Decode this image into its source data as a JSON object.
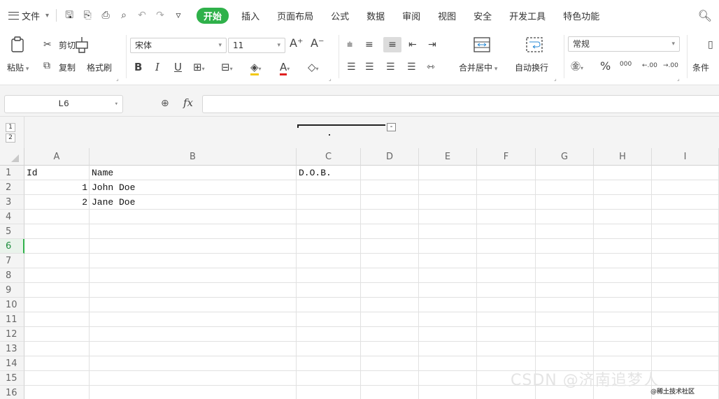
{
  "menu": {
    "file_label": "文件",
    "tabs": [
      "开始",
      "插入",
      "页面布局",
      "公式",
      "数据",
      "审阅",
      "视图",
      "安全",
      "开发工具",
      "特色功能"
    ]
  },
  "ribbon": {
    "paste": "粘贴",
    "cut": "剪切",
    "copy": "复制",
    "format_painter": "格式刷",
    "font_name": "宋体",
    "font_size": "11",
    "merge_center": "合并居中",
    "wrap_text": "自动换行",
    "number_format": "常规",
    "percent": "%",
    "thousands": "000",
    "dec_inc": ".00",
    "dec_dec": ".00",
    "conditional": "条件"
  },
  "formula_bar": {
    "name_box": "L6",
    "fx_label": "fx",
    "formula": ""
  },
  "outline": {
    "levels": [
      "1",
      "2"
    ],
    "collapse": "-"
  },
  "sheet": {
    "columns": [
      "A",
      "B",
      "C",
      "D",
      "E",
      "F",
      "G",
      "H",
      "I"
    ],
    "rows": [
      "1",
      "2",
      "3",
      "4",
      "5",
      "6",
      "7",
      "8",
      "9",
      "10",
      "11",
      "12",
      "13",
      "14",
      "15",
      "16"
    ],
    "active_row": "6",
    "cells": {
      "A1": "Id",
      "B1": "Name",
      "C1": "D.O.B.",
      "A2": "1",
      "B2": "John Doe",
      "A3": "2",
      "B3": "Jane Doe"
    }
  },
  "watermark": {
    "main": "CSDN @济南追梦人",
    "sub": "@稀土技术社区"
  },
  "colors": {
    "accent_green": "#2fb14a",
    "header_bg": "#f4f4f4",
    "grid_line": "#e1e1e1"
  },
  "icons": [
    "menu-icon",
    "save-icon",
    "undo-icon",
    "redo-icon",
    "print-icon",
    "print-preview-icon",
    "search-icon",
    "paste-icon",
    "cut-icon",
    "copy-icon",
    "format-painter-icon",
    "bold-icon",
    "italic-icon",
    "underline-icon",
    "border-icon",
    "fill-color-icon",
    "font-color-icon",
    "eraser-icon",
    "align-top-icon",
    "align-middle-icon",
    "align-bottom-icon",
    "indent-icon",
    "outdent-icon",
    "merge-icon",
    "wrap-icon",
    "currency-icon",
    "zoom-icon"
  ]
}
